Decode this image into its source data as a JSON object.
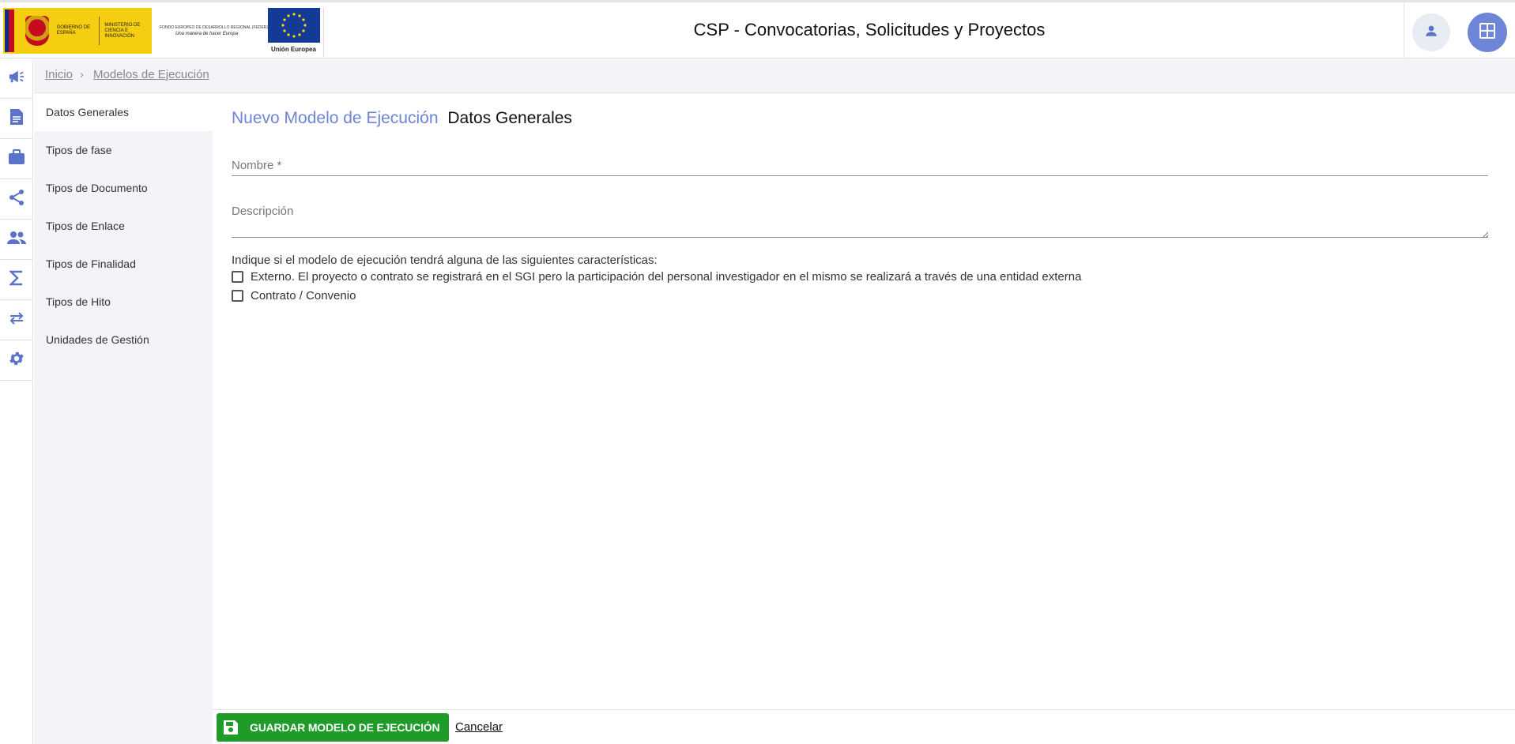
{
  "header": {
    "logo_gobierno_text": "GOBIERNO DE ESPAÑA",
    "logo_ministerio_text": "MINISTERIO DE CIENCIA E INNOVACIÓN",
    "logo_feder_line1": "FONDO EUROPEO DE DESARROLLO REGIONAL (FEDER)",
    "logo_feder_line2": "Una manera de hacer Europa",
    "logo_eu_text": "Unión Europea",
    "app_title": "CSP - Convocatorias, Solicitudes y Proyectos",
    "user_icon": "person-icon",
    "apps_icon": "grid-icon"
  },
  "rail": {
    "items": [
      {
        "icon": "megaphone-icon"
      },
      {
        "icon": "document-icon"
      },
      {
        "icon": "briefcase-icon"
      },
      {
        "icon": "share-icon"
      },
      {
        "icon": "people-icon"
      },
      {
        "icon": "sigma-icon"
      },
      {
        "icon": "swap-icon"
      },
      {
        "icon": "gear-icon"
      }
    ],
    "accent": "#6e85d8"
  },
  "breadcrumb": {
    "home": "Inicio",
    "separator": "›",
    "current": "Modelos de Ejecución"
  },
  "sections": {
    "items": [
      {
        "label": "Datos Generales"
      },
      {
        "label": "Tipos de fase"
      },
      {
        "label": "Tipos de Documento"
      },
      {
        "label": "Tipos de Enlace"
      },
      {
        "label": "Tipos de Finalidad"
      },
      {
        "label": "Tipos de Hito"
      },
      {
        "label": "Unidades de Gestión"
      }
    ],
    "active": "Datos Generales"
  },
  "form": {
    "title": "Nuevo Modelo de Ejecución",
    "subtitle": "Datos Generales",
    "nombre_label": "Nombre *",
    "nombre_value": "",
    "descripcion_label": "Descripción",
    "descripcion_value": "",
    "hint": "Indique si el modelo de ejecución tendrá alguna de las siguientes características:",
    "checks": [
      {
        "label": "Externo. El proyecto o contrato se registrará en el SGI pero la participación del personal investigador en el mismo se realizará a través de una entidad externa",
        "checked": false
      },
      {
        "label": "Contrato / Convenio",
        "checked": false
      }
    ]
  },
  "footer": {
    "save_label": "GUARDAR MODELO DE EJECUCIÓN",
    "cancel_label": "Cancelar",
    "save_color": "#1f9b2a"
  }
}
